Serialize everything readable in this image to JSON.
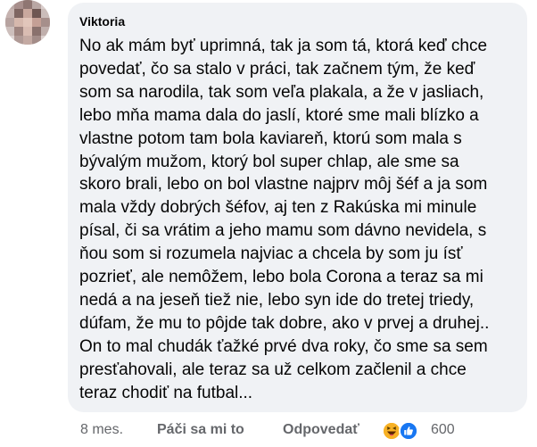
{
  "comment": {
    "author": "Viktoria",
    "text_lines": [
      "No ak mám byť uprimná, tak ja som tá, ktorá keď chce",
      "povedať, čo sa stalo v práci, tak začnem tým, že keď",
      "som sa narodila, tak som veľa plakala, a že v jasliach,",
      "lebo mňa mama dala do jaslí, ktoré sme mali blízko a",
      "vlastne potom tam bola kaviareň, ktorú som mala s",
      "bývalým mužom, ktorý bol super chlap, ale sme sa",
      "skoro brali, lebo on bol vlastne najprv môj šéf a ja som",
      "mala vždy dobrých šéfov, aj ten z Rakúska mi minule",
      "písal, či sa vrátim a jeho mamu som dávno nevidela, s",
      "ňou som si rozumela najviac a chcela by som ju ísť",
      "pozrieť, ale nemôžem, lebo bola Corona a teraz sa mi",
      "nedá a na jeseň tiež nie, lebo syn ide do tretej triedy,",
      "dúfam, že mu to pôjde tak dobre, ako v prvej a druhej..",
      "On to mal chudák ťažké prvé dva roky, čo sme sa sem",
      "presťahovali, ale teraz sa už celkom začlenil a chce",
      "teraz chodiť na futbal..."
    ]
  },
  "actions": {
    "time": "8 mes.",
    "like_label": "Páči sa mi to",
    "reply_label": "Odpovedať",
    "reaction_count": "600",
    "reaction_icons": [
      "haha-icon",
      "like-icon"
    ]
  },
  "colors": {
    "bubble_bg": "#f0f2f5",
    "secondary_text": "#65676b",
    "like_blue": "#1877f2",
    "haha_yellow": "#f7b125"
  }
}
